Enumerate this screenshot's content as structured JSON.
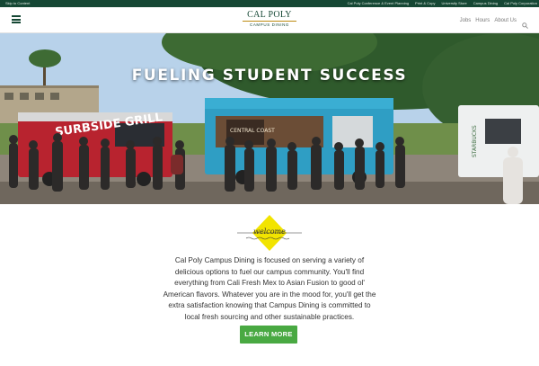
{
  "topbar": {
    "skip_link": "Skip to Content",
    "links": [
      "Cal Poly Conference & Event Planning",
      "Print & Copy",
      "University Store",
      "Campus Dining",
      "Cal Poly Corporation"
    ]
  },
  "header": {
    "logo_brand": "CAL POLY",
    "logo_sub": "CAMPUS DINING",
    "nav": [
      "Jobs",
      "Hours",
      "About Us"
    ]
  },
  "hero": {
    "title": "Fueling Student Success",
    "truck_left_sign": "SURBSIDE GRILL",
    "truck_center_sign": "CENTRAL COAST",
    "truck_right_sign": "STARBUCKS"
  },
  "welcome": {
    "badge_text": "welcome",
    "body": "Cal Poly Campus Dining is focused on serving a variety of delicious options to fuel our campus community. You'll find everything from Cali Fresh Mex to Asian Fusion to good ol' American flavors. Whatever you are in the mood for, you'll get the extra satisfaction knowing that Campus Dining is committed to local fresh sourcing and other sustainable practices.",
    "cta_label": "LEARN MORE"
  },
  "colors": {
    "brand_green": "#154734",
    "button_green": "#49a942",
    "badge_yellow": "#f2e400",
    "gold": "#bd8b13"
  },
  "icons": {
    "menu": "hamburger-menu-icon",
    "search": "search-icon"
  }
}
